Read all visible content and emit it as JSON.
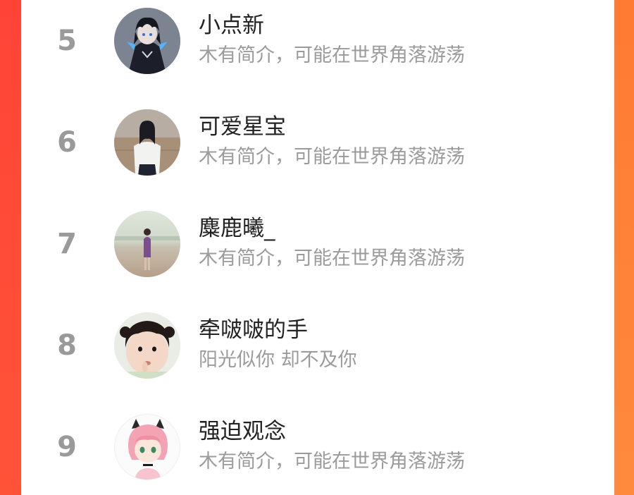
{
  "ranking": {
    "items": [
      {
        "rank": "5",
        "name": "小点新",
        "bio": "木有简介，可能在世界角落游荡",
        "avatar_icon": "anime-dark-haired-character-avatar"
      },
      {
        "rank": "6",
        "name": "可爱星宝",
        "bio": "木有简介，可能在世界角落游荡",
        "avatar_icon": "girl-white-shirt-avatar"
      },
      {
        "rank": "7",
        "name": "麋鹿曦_",
        "bio": "木有简介，可能在世界角落游荡",
        "avatar_icon": "person-on-beach-avatar"
      },
      {
        "rank": "8",
        "name": "牵啵啵的手",
        "bio": "阳光似你 却不及你",
        "avatar_icon": "toddler-photo-avatar"
      },
      {
        "rank": "9",
        "name": "强迫观念",
        "bio": "木有简介，可能在世界角落游荡",
        "avatar_icon": "anime-pink-hair-girl-avatar"
      }
    ]
  },
  "colors": {
    "frame_left": "#ff4437",
    "frame_right": "#ff8a3e",
    "rank_text": "#9a9a9a",
    "name_text": "#222222",
    "bio_text": "#9b9b9b"
  }
}
